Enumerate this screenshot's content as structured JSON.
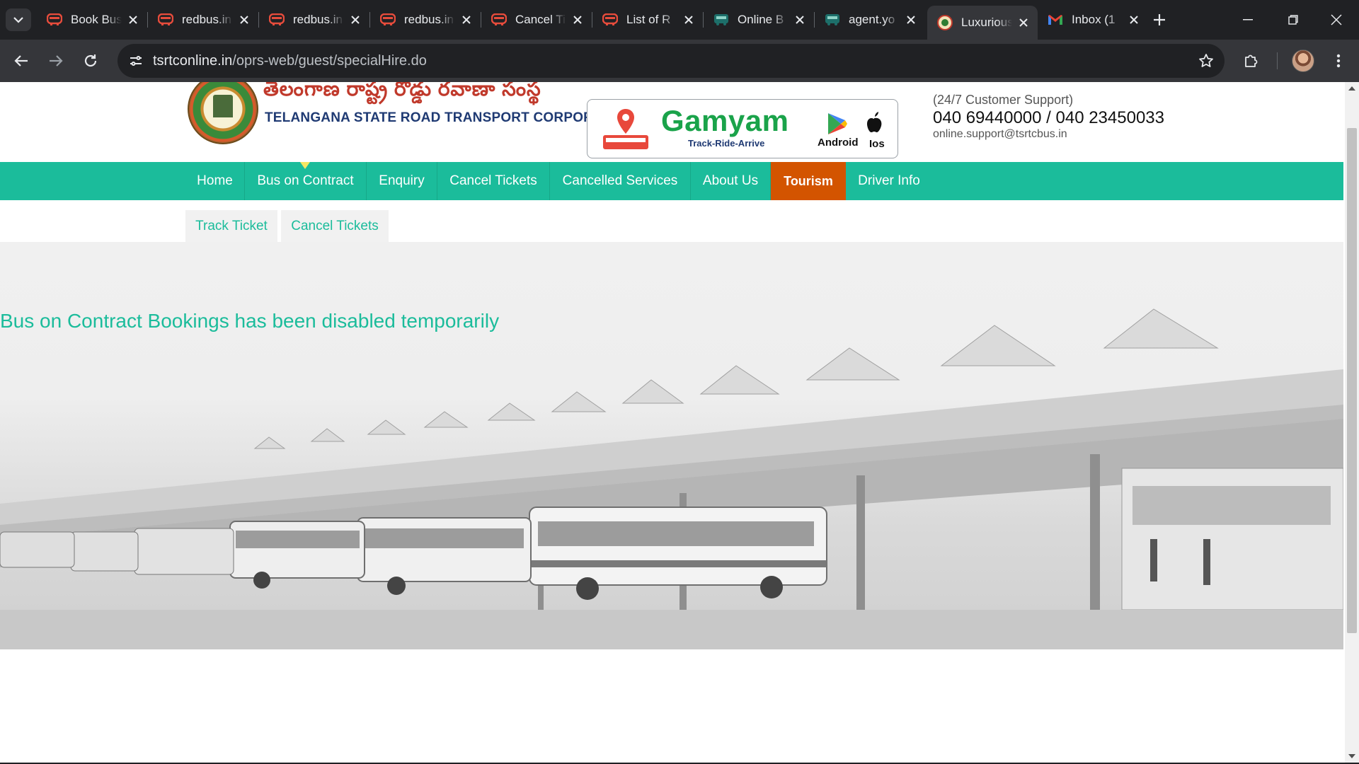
{
  "browser": {
    "tabs": [
      {
        "title": "Book Bus Tickets",
        "favicon": "redbus"
      },
      {
        "title": "redbus.in",
        "favicon": "redbus"
      },
      {
        "title": "redbus.in",
        "favicon": "redbus"
      },
      {
        "title": "redbus.in",
        "favicon": "redbus"
      },
      {
        "title": "Cancel Ticket",
        "favicon": "redbus"
      },
      {
        "title": "List of R",
        "favicon": "redbus"
      },
      {
        "title": "Online B",
        "favicon": "bus-teal"
      },
      {
        "title": "agent.yo",
        "favicon": "bus-teal"
      },
      {
        "title": "Luxurious",
        "favicon": "tsrtc"
      },
      {
        "title": "Inbox (1",
        "favicon": "gmail"
      }
    ],
    "active_tab_index": 8,
    "url_domain": "tsrtconline.in",
    "url_path": "/oprs-web/guest/specialHire.do"
  },
  "header": {
    "telugu_title": "తెలంగాణ రాష్ట్ర రోడ్డు రవాణా సంస్థ",
    "english_title": "TELANGANA STATE ROAD TRANSPORT CORPORATION",
    "app_banner": {
      "name": "Gamyam",
      "tagline": "Track-Ride-Arrive",
      "android_label": "Android",
      "ios_label": "Ios"
    },
    "support": {
      "label": "(24/7 Customer Support)",
      "phone": "040 69440000 / 040 23450033",
      "email": "online.support@tsrtcbus.in"
    }
  },
  "nav": {
    "items": [
      {
        "label": "Home"
      },
      {
        "label": "Bus on Contract"
      },
      {
        "label": "Enquiry"
      },
      {
        "label": "Cancel Tickets"
      },
      {
        "label": "Cancelled Services"
      },
      {
        "label": "About Us"
      },
      {
        "label": "Tourism"
      },
      {
        "label": "Driver Info"
      }
    ],
    "active": "Bus on Contract"
  },
  "subnav": {
    "items": [
      {
        "label": "Track Ticket"
      },
      {
        "label": "Cancel Tickets"
      }
    ]
  },
  "main": {
    "message": "Bus on Contract Bookings has been disabled temporarily"
  },
  "colors": {
    "nav_bg": "#1bbc9b",
    "tourism_bg": "#d35400",
    "accent_text": "#1bbc9b",
    "chrome_dark": "#202124"
  }
}
